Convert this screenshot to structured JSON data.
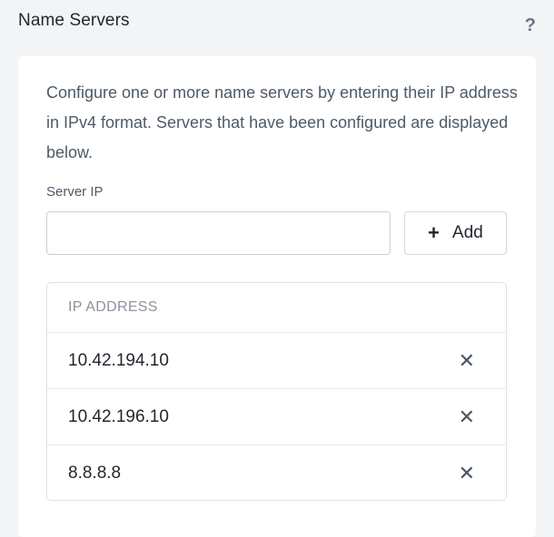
{
  "header": {
    "title": "Name Servers",
    "help_icon": "?"
  },
  "card": {
    "description": "Configure one or more name servers by entering their IP address in IPv4 format. Servers that have been configured are displayed below.",
    "server_ip": {
      "label": "Server IP",
      "value": "",
      "placeholder": ""
    },
    "add_button": {
      "icon": "+",
      "label": "Add"
    },
    "table": {
      "column_header": "IP ADDRESS",
      "rows": [
        {
          "ip": "10.42.194.10",
          "remove_icon": "✕"
        },
        {
          "ip": "10.42.196.10",
          "remove_icon": "✕"
        },
        {
          "ip": "8.8.8.8",
          "remove_icon": "✕"
        }
      ]
    }
  }
}
